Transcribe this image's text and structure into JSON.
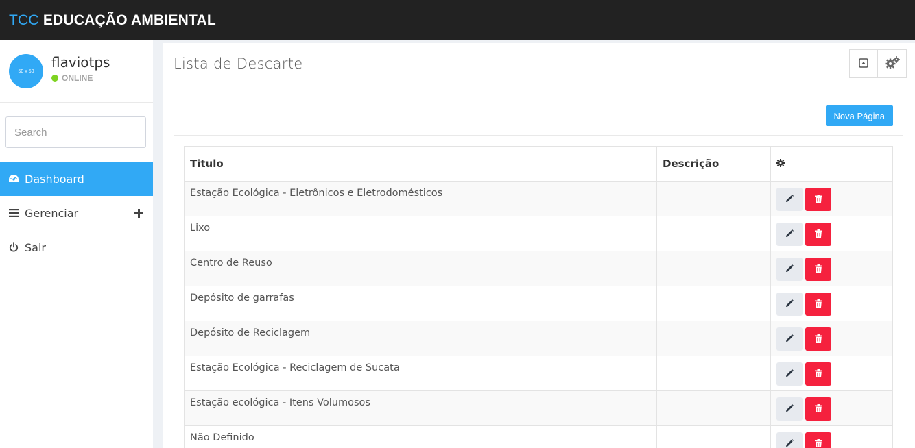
{
  "header": {
    "brand_accent": "TCC",
    "brand_main": "EDUCAÇÃO AMBIENTAL"
  },
  "sidebar": {
    "avatar_text": "50 x 50",
    "username": "flaviotps",
    "status": "ONLINE",
    "search_placeholder": "Search",
    "menu": [
      {
        "label": "Dashboard",
        "icon": "dashboard-icon",
        "active": true
      },
      {
        "label": "Gerenciar",
        "icon": "bars-icon",
        "active": false
      },
      {
        "label": "Sair",
        "icon": "power-icon",
        "active": false
      }
    ]
  },
  "panel": {
    "title": "Lista de Descarte",
    "new_button": "Nova Página"
  },
  "table": {
    "headers": [
      "Titulo",
      "Descrição"
    ],
    "rows": [
      {
        "titulo": "Estação Ecológica - Eletrônicos e Eletrodomésticos",
        "descricao": ""
      },
      {
        "titulo": "Lixo",
        "descricao": ""
      },
      {
        "titulo": "Centro de Reuso",
        "descricao": ""
      },
      {
        "titulo": "Depósito de garrafas",
        "descricao": ""
      },
      {
        "titulo": "Depósito de Reciclagem",
        "descricao": ""
      },
      {
        "titulo": "Estação Ecológica - Reciclagem de Sucata",
        "descricao": ""
      },
      {
        "titulo": "Estação ecológica - Itens Volumosos",
        "descricao": ""
      },
      {
        "titulo": "Não Definido",
        "descricao": ""
      }
    ]
  },
  "colors": {
    "accent": "#31a9f5",
    "topbar": "#222222",
    "online": "#7ed321",
    "danger": "#f5213e"
  }
}
